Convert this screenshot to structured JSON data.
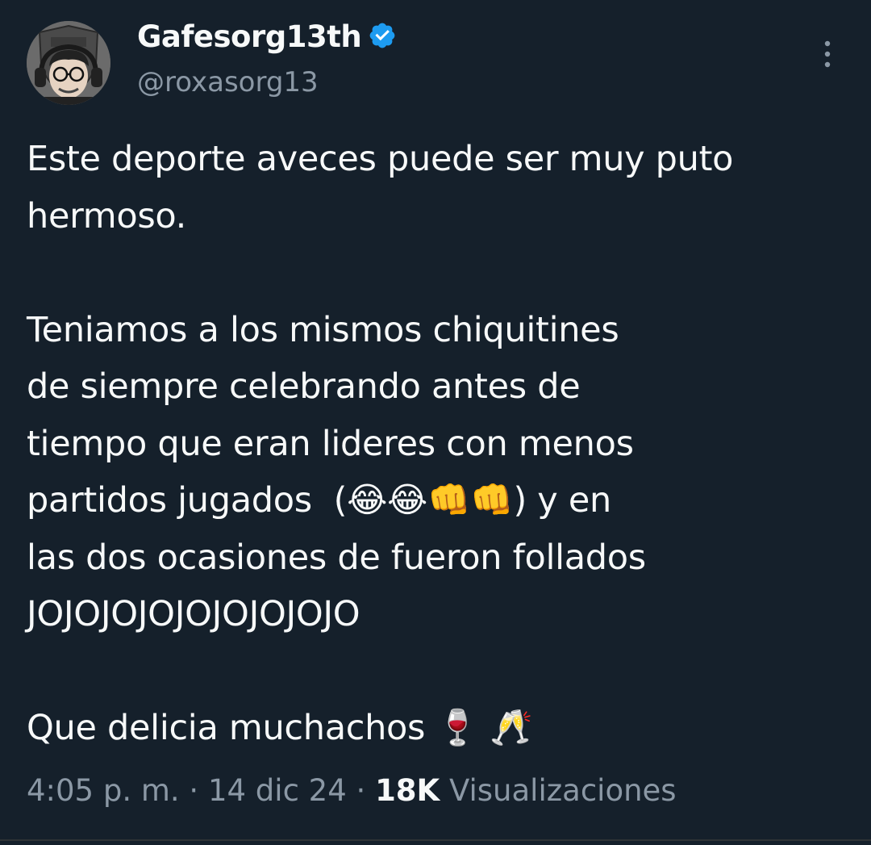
{
  "author": {
    "display_name": "Gafesorg13th",
    "handle": "@roxasorg13",
    "verified": true,
    "verified_color": "#1d9bf0"
  },
  "tweet": {
    "text_part1": "Este deporte aveces puede ser muy puto\nhermoso.\n\nTeniamos a los mismos chiquitines\nde siempre celebrando antes de\ntiempo que eran lideres con menos\npartidos jugados  (",
    "emoji_group": "😂😂👊👊",
    "text_part2": ") y en\nlas dos ocasiones de fueron follados\nJOJOJOJOJOJOJOJOJO\n\nQue delicia muchachos ",
    "trailing_emoji": "🍷 🥂"
  },
  "meta": {
    "time": "4:05 p. m.",
    "separator1": " · ",
    "date": "14 dic 24",
    "separator2": " · ",
    "views_count": "18K",
    "views_label": " Visualizaciones"
  },
  "icons": {
    "more": "more-options-icon",
    "verified": "verified-badge-icon"
  },
  "colors": {
    "background": "#15202b",
    "text": "#f7f9f9",
    "secondary": "#8b98a5"
  }
}
